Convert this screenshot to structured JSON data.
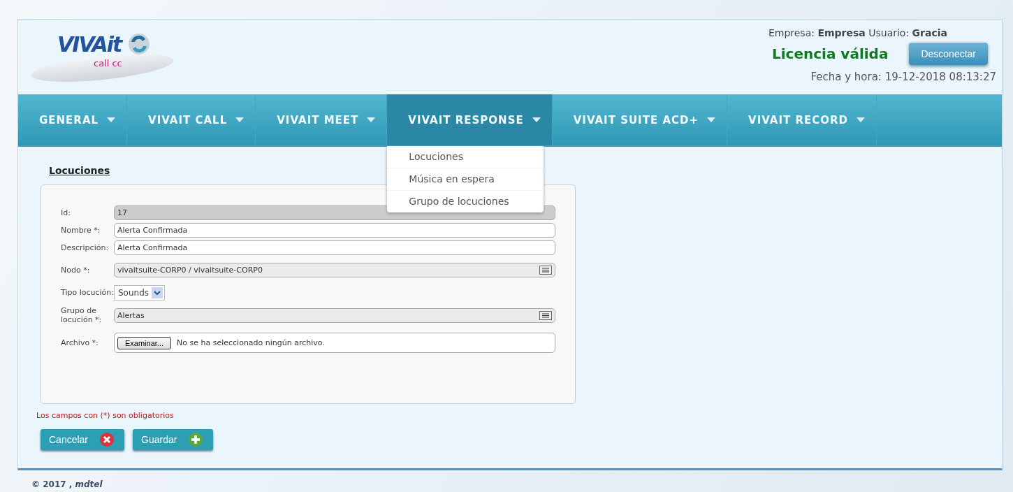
{
  "header": {
    "logo_text": "VIVAit",
    "logo_sub": "call cc",
    "empresa_label": "Empresa:",
    "empresa": "Empresa",
    "usuario_label": "Usuario:",
    "usuario": "Gracia",
    "license": "Licencia válida",
    "disconnect": "Desconectar",
    "datetime": "Fecha y hora: 19-12-2018 08:13:27"
  },
  "nav": [
    {
      "label": "GENERAL",
      "selected": false
    },
    {
      "label": "VIVAIT CALL",
      "selected": false
    },
    {
      "label": "VIVAIT MEET",
      "selected": false
    },
    {
      "label": "VIVAIT RESPONSE",
      "selected": true
    },
    {
      "label": "VIVAIT SUITE ACD+",
      "selected": false
    },
    {
      "label": "VIVAIT RECORD",
      "selected": false
    }
  ],
  "menu": [
    "Locuciones",
    "Música en espera",
    "Grupo de locuciones"
  ],
  "page_title": "Locuciones",
  "fields": [
    {
      "kind": "readonly",
      "label": "Id:",
      "value": "17"
    },
    {
      "kind": "text",
      "label": "Nombre *:",
      "value": "Alerta Confirmada"
    },
    {
      "kind": "text",
      "label": "Descripción:",
      "value": "Alerta Confirmada"
    },
    {
      "kind": "lookup",
      "label": "Nodo *:",
      "value": "vivaitsuite-CORP0 / vivaitsuite-CORP0"
    },
    {
      "kind": "select",
      "label": "Tipo locución:",
      "value": "Sounds"
    },
    {
      "kind": "lookup",
      "label": "Grupo de locución *:",
      "value": "Alertas"
    },
    {
      "kind": "file",
      "label": "Archivo *:",
      "button": "Examinar...",
      "value": "No se ha seleccionado ningún archivo."
    }
  ],
  "required_note": "Los campos con (*) son obligatorios",
  "buttons": [
    {
      "kind": "cancel",
      "label": "Cancelar"
    },
    {
      "kind": "save",
      "label": "Guardar"
    }
  ],
  "footer": {
    "year": "© 2017 ,",
    "company": "mdtel"
  }
}
